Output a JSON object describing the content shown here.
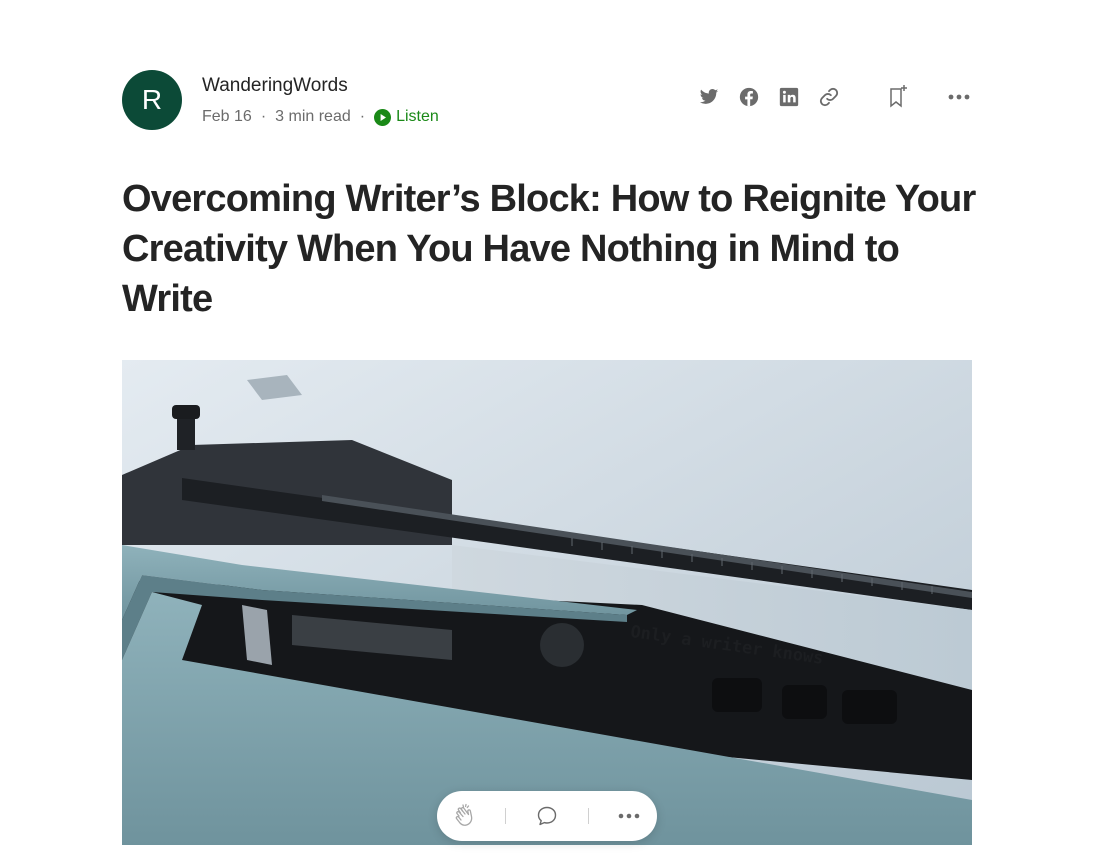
{
  "author": {
    "initial": "R",
    "name": "WanderingWords",
    "avatar_color": "#0c4a37"
  },
  "meta": {
    "date": "Feb 16",
    "read_time": "3 min read",
    "separator": "·",
    "listen_label": "Listen",
    "listen_color": "#1a8917"
  },
  "share_icons": [
    "twitter-icon",
    "facebook-icon",
    "linkedin-icon",
    "link-icon",
    "bookmark-add-icon",
    "more-icon"
  ],
  "article": {
    "title": "Overcoming Writer’s Block: How to Reignite Your Creativity When You Have Nothing in Mind to Write"
  },
  "hero_image": {
    "typed_text": "Only a writer knows",
    "description_colors": {
      "paper": "#c9d4dd",
      "body": "#7fa3ad",
      "dark": "#1a1d20"
    }
  },
  "action_bar": {
    "icons": [
      "clap-icon",
      "comment-icon",
      "more-icon"
    ]
  }
}
